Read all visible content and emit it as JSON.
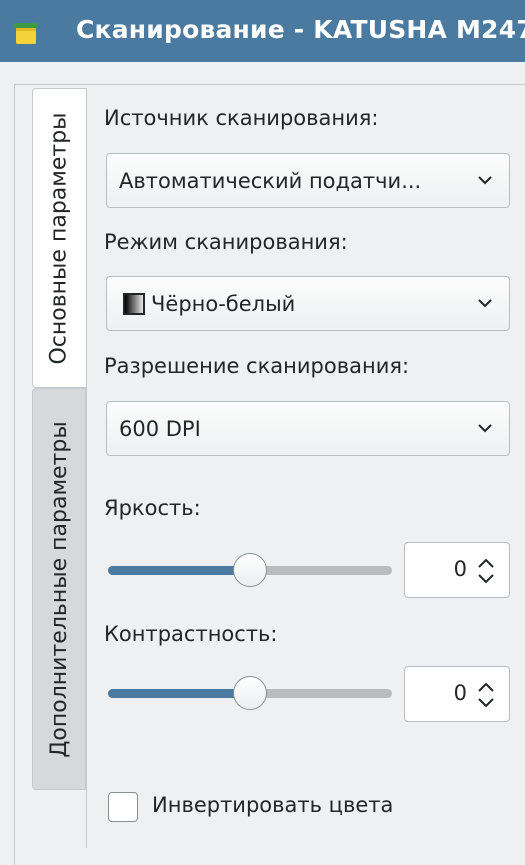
{
  "window": {
    "title": "Сканирование - KATUSHA M247"
  },
  "colors": {
    "titlebar": "#4a7aa0",
    "accent": "#4a7aa0"
  },
  "tabs": [
    {
      "label": "Основные параметры",
      "active": true
    },
    {
      "label": "Дополнительные параметры",
      "active": false
    }
  ],
  "source": {
    "label": "Источник сканирования:",
    "value": "Автоматический податчи..."
  },
  "mode": {
    "label": "Режим сканирования:",
    "value": "Чёрно-белый",
    "icon": "grayscale-gradient-icon"
  },
  "resolution": {
    "label": "Разрешение сканирования:",
    "value": "600 DPI"
  },
  "brightness": {
    "label": "Яркость:",
    "value": "0",
    "slider_level": 0.5
  },
  "contrast": {
    "label": "Контрастность:",
    "value": "0",
    "slider_level": 0.5
  },
  "invert": {
    "label": "Инвертировать цвета",
    "checked": false
  }
}
